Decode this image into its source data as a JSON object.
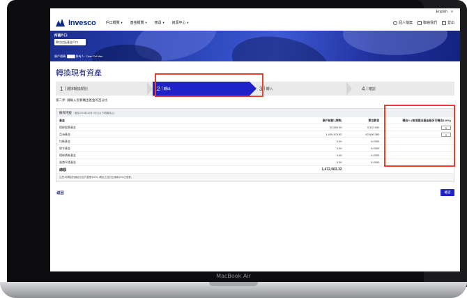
{
  "device": {
    "label": "MacBook Air"
  },
  "topbar": {
    "language": "English",
    "menu_icon": "≡"
  },
  "brand": {
    "name": "Invesco"
  },
  "nav": {
    "items": [
      {
        "label": "戶口概覽"
      },
      {
        "label": "基金概覽"
      },
      {
        "label": "搜尋"
      },
      {
        "label": "資源中心"
      }
    ],
    "right": [
      {
        "icon": "user-icon",
        "label": "個人檔案"
      },
      {
        "icon": "mail-icon",
        "label": "聯絡我們"
      },
      {
        "icon": "logout-icon",
        "label": "登出"
      }
    ]
  },
  "account": {
    "title": "所選戶口:",
    "selected": "單位信託基金戶口",
    "holder": "賬戶號碼: ████  持有人: Chan Tai Man"
  },
  "page": {
    "title": "轉換現有資產"
  },
  "steps": [
    {
      "num": "1",
      "label": "選擇轉換類別"
    },
    {
      "num": "2",
      "label": "轉出"
    },
    {
      "num": "3",
      "label": "轉入"
    },
    {
      "num": "4",
      "label": "確認"
    }
  ],
  "active_step": 1,
  "hint": "第二步: 請輸入您要轉出基金的百分比",
  "table": {
    "title": "擁有持股",
    "subtitle": "截至2018年10月19日 (以下價格為止)",
    "headers": {
      "fund": "基金",
      "value": "賬戶結餘 (港幣)",
      "units": "單位數目",
      "pct": "轉出% (每項選出基金最多可轉出100%)"
    },
    "rows": [
      {
        "fund": "環球股票基金",
        "value": "62,586.50",
        "units": "3,310.000",
        "pct": "0"
      },
      {
        "fund": "亞洲基金",
        "value": "1,409,476.82",
        "units": "82,606.380",
        "pct": "0"
      },
      {
        "fund": "均衡基金",
        "value": "0.00",
        "units": "0.0000",
        "pct": ""
      },
      {
        "fund": "保守基金",
        "value": "0.00",
        "units": "0.0000",
        "pct": ""
      },
      {
        "fund": "環球債券基金",
        "value": "0.00",
        "units": "0.0000",
        "pct": ""
      },
      {
        "fund": "香港平穩基金",
        "value": "0.00",
        "units": "0.0000",
        "pct": ""
      }
    ],
    "total": {
      "label": "總額",
      "value": "1,472,063.32"
    },
    "note": "注意:可轉出的總百分比只能是100%, 轉出之百分比須為10%之倍數。"
  },
  "actions": {
    "back": "‹返回",
    "confirm": "確認"
  },
  "colors": {
    "brand_blue": "#1f22c9",
    "highlight": "#e8402f",
    "title_blue": "#1a237e"
  }
}
